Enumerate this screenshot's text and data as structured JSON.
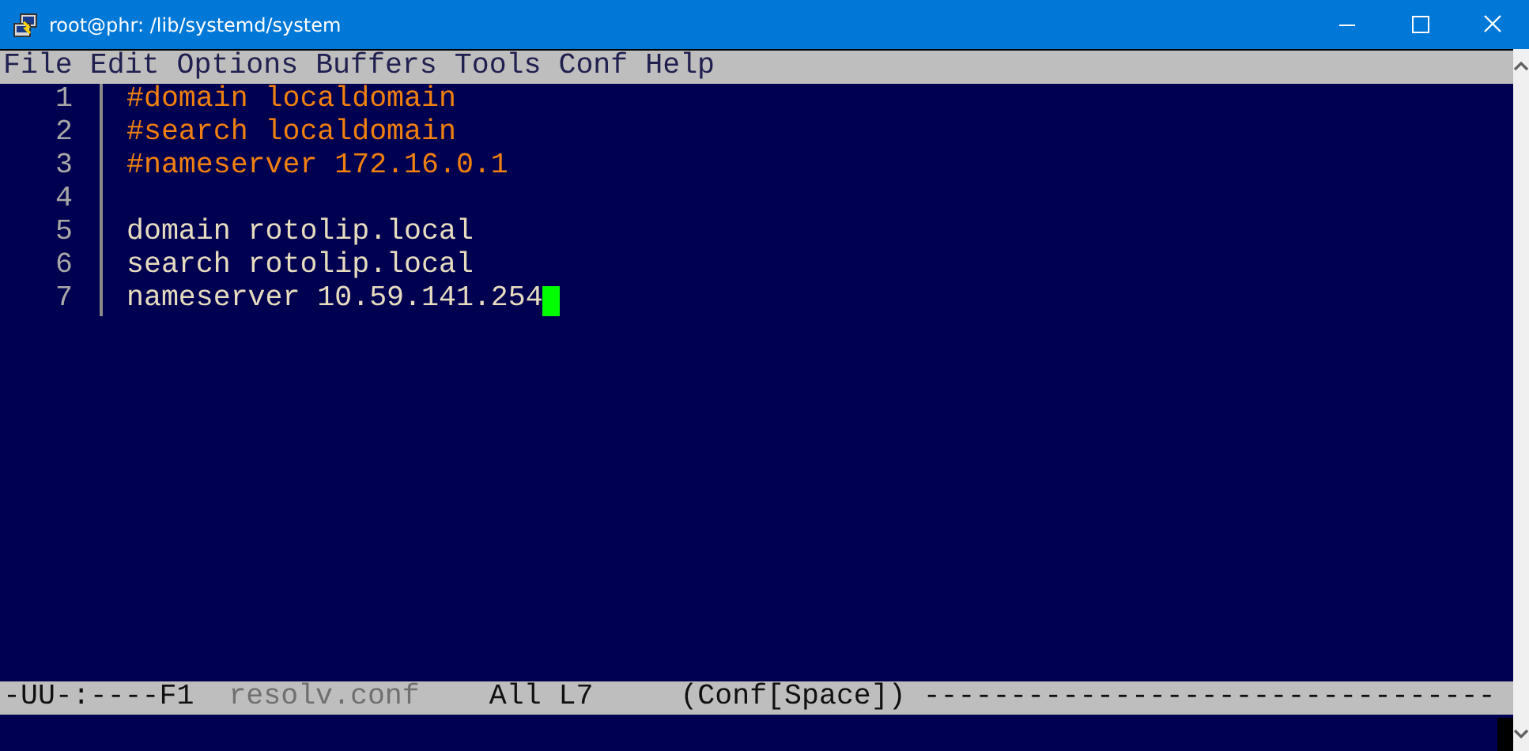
{
  "window": {
    "title": "root@phr: /lib/systemd/system"
  },
  "menu": [
    "File",
    "Edit",
    "Options",
    "Buffers",
    "Tools",
    "Conf",
    "Help"
  ],
  "lines": [
    {
      "number": "1",
      "text": "#domain localdomain",
      "kind": "comment",
      "cursor": false
    },
    {
      "number": "2",
      "text": "#search localdomain",
      "kind": "comment",
      "cursor": false
    },
    {
      "number": "3",
      "text": "#nameserver 172.16.0.1",
      "kind": "comment",
      "cursor": false
    },
    {
      "number": "4",
      "cursor": false
    },
    {
      "number": "5",
      "text": "domain rotolip.local",
      "kind": "plain",
      "cursor": false
    },
    {
      "number": "6",
      "text": "search rotolip.local",
      "kind": "plain",
      "cursor": false
    },
    {
      "number": "7",
      "text": "nameserver 10.59.141.254",
      "kind": "plain",
      "cursor": true
    }
  ],
  "mode_line": [
    {
      "text": "-UU-:----F1",
      "kind": "status"
    },
    {
      "text": "resolv.conf",
      "kind": "buffer"
    },
    {
      "text": "All L7",
      "kind": "status"
    },
    {
      "text": "(Conf[Space])",
      "kind": "status"
    },
    {
      "text": "---------------------------------",
      "kind": "status"
    }
  ]
}
